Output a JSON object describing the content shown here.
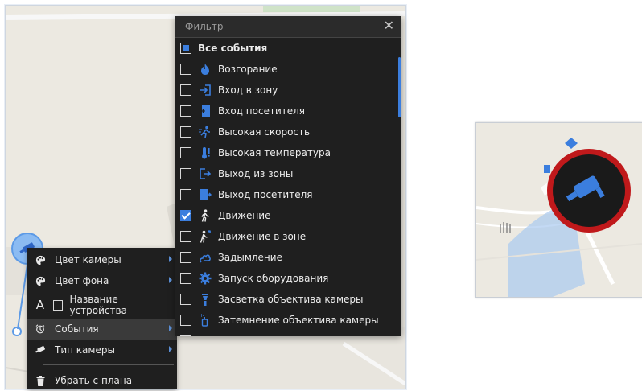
{
  "filter": {
    "title": "Фильтр",
    "close_label": "✕",
    "items": [
      {
        "label": "Все события",
        "state": "partial",
        "icon": "none"
      },
      {
        "label": "Возгорание",
        "state": "unchecked",
        "icon": "fire-icon"
      },
      {
        "label": "Вход в зону",
        "state": "unchecked",
        "icon": "zone-enter-icon"
      },
      {
        "label": "Вход посетителя",
        "state": "unchecked",
        "icon": "visitor-enter-icon"
      },
      {
        "label": "Высокая скорость",
        "state": "unchecked",
        "icon": "speed-runner-icon"
      },
      {
        "label": "Высокая температура",
        "state": "unchecked",
        "icon": "thermometer-icon"
      },
      {
        "label": "Выход из зоны",
        "state": "unchecked",
        "icon": "zone-exit-icon"
      },
      {
        "label": "Выход посетителя",
        "state": "unchecked",
        "icon": "visitor-exit-icon"
      },
      {
        "label": "Движение",
        "state": "checked",
        "icon": "walking-person-icon"
      },
      {
        "label": "Движение в зоне",
        "state": "unchecked",
        "icon": "zone-motion-icon"
      },
      {
        "label": "Задымление",
        "state": "unchecked",
        "icon": "smoke-icon"
      },
      {
        "label": "Запуск оборудования",
        "state": "unchecked",
        "icon": "gear-icon"
      },
      {
        "label": "Засветка объектива камеры",
        "state": "unchecked",
        "icon": "lens-flare-icon"
      },
      {
        "label": "Затемнение объектива камеры",
        "state": "unchecked",
        "icon": "lens-dark-icon"
      }
    ]
  },
  "context_menu": {
    "items": [
      {
        "label": "Цвет камеры",
        "icon": "palette-icon",
        "has_submenu": true
      },
      {
        "label": "Цвет фона",
        "icon": "palette-icon",
        "has_submenu": true
      },
      {
        "label": "Название устройства",
        "icon": "text-icon",
        "has_submenu": false,
        "checkbox": true
      },
      {
        "label": "События",
        "icon": "alarm-clock-icon",
        "has_submenu": true,
        "highlighted": true
      },
      {
        "label": "Тип камеры",
        "icon": "camera-icon",
        "has_submenu": true
      },
      {
        "label": "Убрать с плана",
        "icon": "trash-icon",
        "has_submenu": false
      }
    ],
    "device_name_letter": "A"
  },
  "colors": {
    "accent": "#3b7ede",
    "menu_bg": "#1f1f1f",
    "map_bg": "#ece9e1",
    "marker_ring": "#c0191b"
  }
}
